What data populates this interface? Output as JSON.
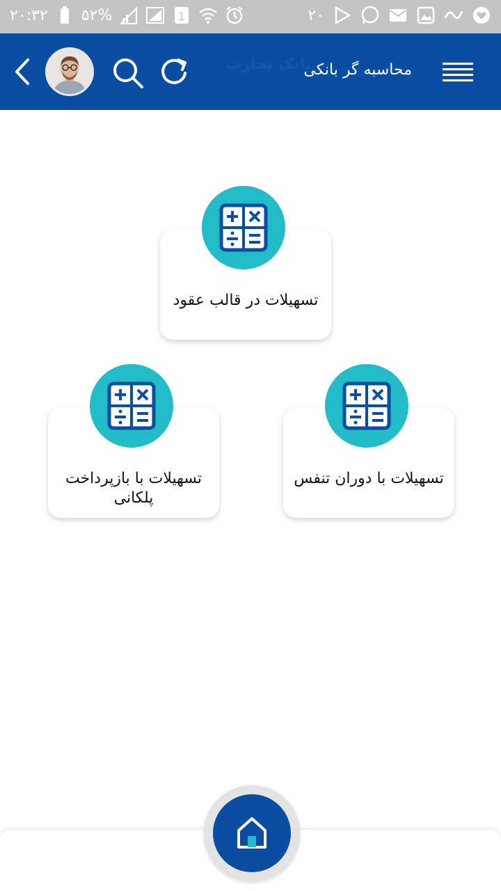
{
  "status_bar": {
    "time": "۲۰:۳۲",
    "battery": "۵۲%",
    "notification_count": "۲۰",
    "sim_label": "1",
    "left_icons": [
      "battery-icon",
      "signal-icon",
      "signal-icon-2",
      "sim-icon",
      "wifi-icon",
      "alarm-icon"
    ],
    "right_icons": [
      "play-store-icon",
      "whatsapp-icon",
      "mail-icon",
      "gallery-icon",
      "app-icon",
      "heart-app-icon"
    ]
  },
  "header": {
    "title": "محاسبه گر بانکی",
    "watermark": "بانک تجارت",
    "icons": [
      "back-icon",
      "avatar",
      "search-icon",
      "refresh-icon",
      "menu-icon"
    ]
  },
  "cards": [
    {
      "label": "تسهیلات در قالب عقود",
      "icon": "calculator-icon"
    },
    {
      "label": "تسهیلات با بازپرداخت پلکانی",
      "icon": "calculator-icon"
    },
    {
      "label": "تسهیلات با دوران تنفس",
      "icon": "calculator-icon"
    }
  ],
  "bottom": {
    "home_icon": "home-icon"
  },
  "colors": {
    "primary": "#0a4ea3",
    "accent": "#21bcc8",
    "status_bar": "#c4c4c4"
  }
}
